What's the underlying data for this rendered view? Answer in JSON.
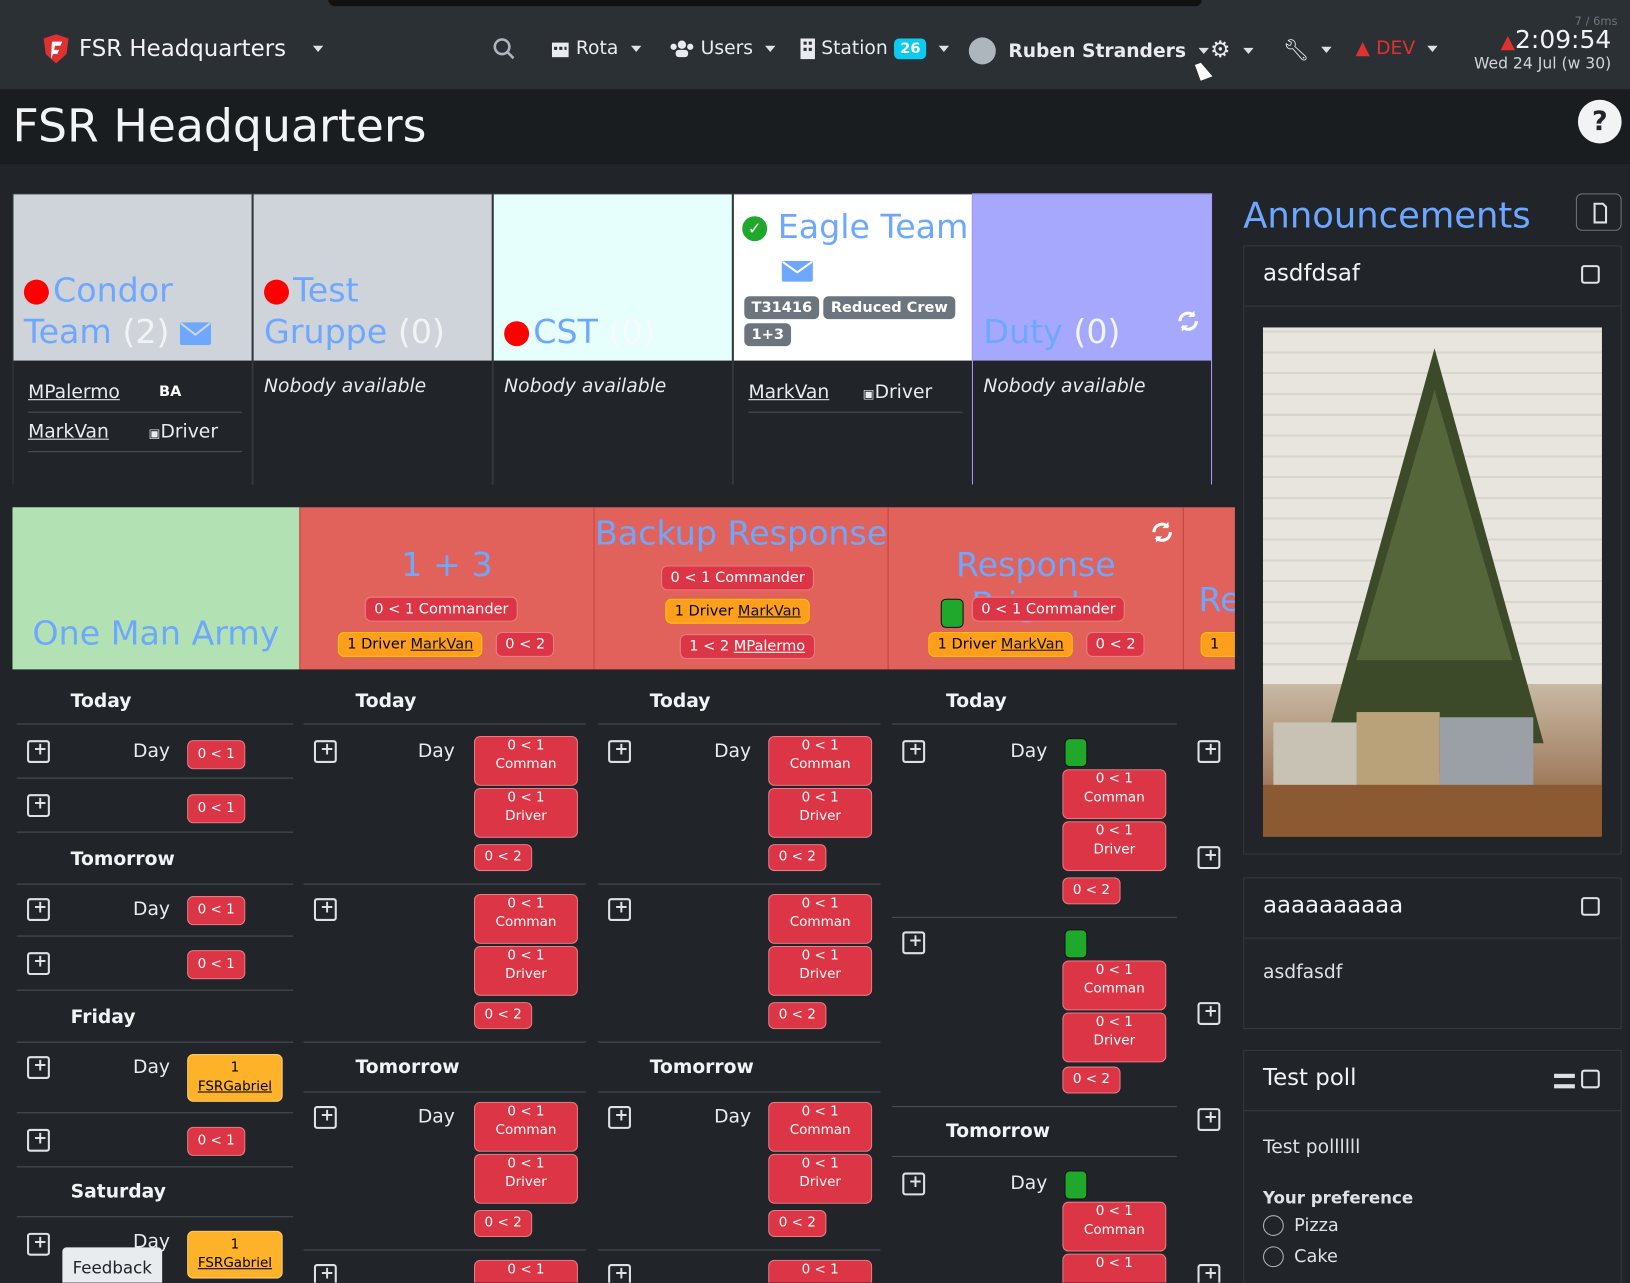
{
  "nav": {
    "brand": "FSR Headquarters",
    "rota": "Rota",
    "users": "Users",
    "station": "Station",
    "station_count": "26",
    "user": "Ruben Stranders",
    "env": "DEV",
    "time": "2:09:54",
    "date": "Wed 24 Jul (w 30)",
    "perf": "7 / 6ms"
  },
  "page": {
    "title": "FSR Headquarters",
    "help": "?"
  },
  "teams": [
    {
      "name": "Condor Team",
      "count": "(2)",
      "members": [
        {
          "name": "MPalermo",
          "role": "BA"
        },
        {
          "name": "MarkVan",
          "role": "Driver"
        }
      ]
    },
    {
      "name": "Test Gruppe",
      "count": "(0)",
      "empty": "Nobody available"
    },
    {
      "name": "CST",
      "count": "(0)",
      "empty": "Nobody available"
    },
    {
      "name": "Eagle Team",
      "tags": [
        "T31416",
        "Reduced Crew",
        "1+3"
      ],
      "members": [
        {
          "name": "MarkVan",
          "role": "Driver"
        }
      ]
    },
    {
      "name": "Duty",
      "count": "(0)",
      "empty": "Nobody available"
    }
  ],
  "rota": {
    "columns": [
      "One Man Army",
      "1 + 3",
      "Backup Response",
      "Response Brigade",
      "Re"
    ],
    "pills": {
      "commander": "0 < 1 Commander",
      "driver_filled": "1 Driver",
      "driver_name": "MarkVan",
      "zero_two": "0 < 2",
      "one_two": "1 < 2",
      "mpalermo": "MPalermo"
    },
    "days": [
      "Today",
      "Tomorrow",
      "Friday",
      "Saturday"
    ],
    "day_label": "Day",
    "zero_one": "0 < 1",
    "commander_short": "Comman",
    "driver_short": "Driver",
    "gabriel": "FSRGabriel",
    "one": "1"
  },
  "announcements": {
    "title": "Announcements",
    "items": [
      {
        "title": "asdfdsaf",
        "image_alt": "christmas tree image"
      },
      {
        "title": "aaaaaaaaaa",
        "body": "asdfasdf"
      },
      {
        "title": "Test poll",
        "body": "Test pollllll",
        "pref": "Your preference",
        "options": [
          "Pizza",
          "Cake"
        ]
      }
    ]
  },
  "feedback": "Feedback",
  "colors": {
    "accent": "#6ea8fe",
    "danger": "#dc3545",
    "warning": "#fd9f1d",
    "success": "#20a82d"
  }
}
